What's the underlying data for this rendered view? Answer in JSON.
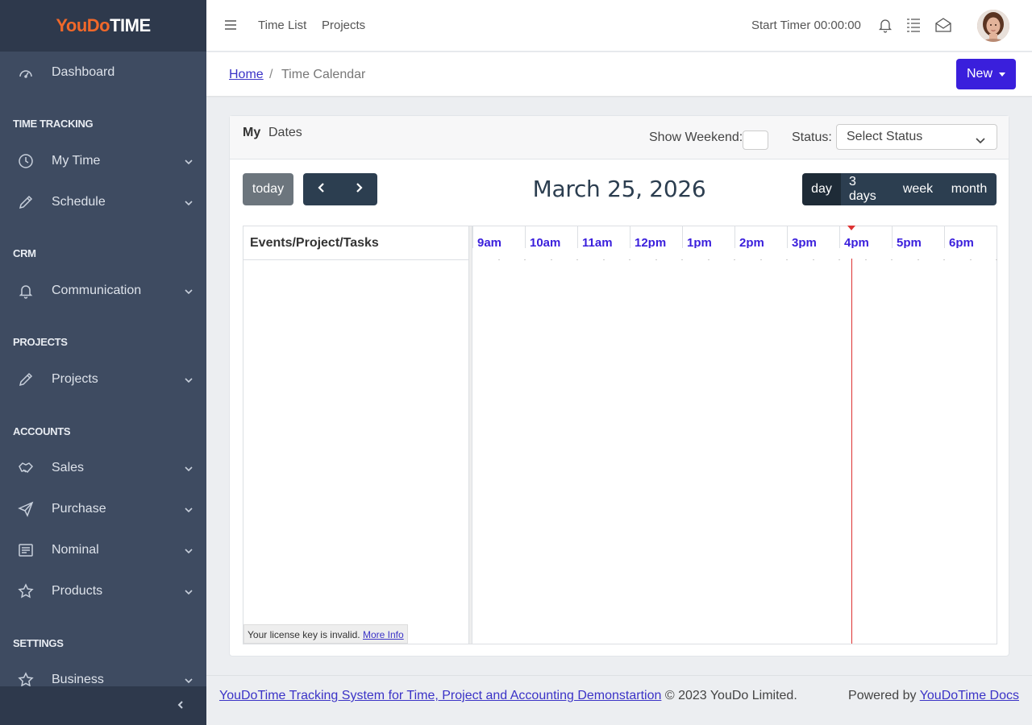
{
  "brand": {
    "part1": "YouDo",
    "part2": "TIME"
  },
  "sidebar": {
    "dashboard": "Dashboard",
    "sections": {
      "time_tracking": "TIME TRACKING",
      "crm": "CRM",
      "projects": "PROJECTS",
      "accounts": "ACCOUNTS",
      "settings": "SETTINGS"
    },
    "items": {
      "my_time": "My Time",
      "schedule": "Schedule",
      "communication": "Communication",
      "projects": "Projects",
      "sales": "Sales",
      "purchase": "Purchase",
      "nominal": "Nominal",
      "products": "Products",
      "business": "Business"
    }
  },
  "topbar": {
    "time_list": "Time List",
    "projects": "Projects",
    "start_timer": "Start Timer 00:00:00"
  },
  "breadcrumb": {
    "home": "Home",
    "separator": "/",
    "current": "Time Calendar"
  },
  "new_button": "New",
  "card": {
    "tab_my": "My",
    "tab_dates": "Dates",
    "show_weekend_label": "Show Weekend:",
    "status_label": "Status:",
    "status_value": "Select Status"
  },
  "calendar": {
    "today": "today",
    "title": "March 25, 2026",
    "views": {
      "day": "day",
      "three_days": "3 days",
      "week": "week",
      "month": "month"
    },
    "active_view": "day",
    "resource_header": "Events/Project/Tasks",
    "hours": [
      "9am",
      "10am",
      "11am",
      "12pm",
      "1pm",
      "2pm",
      "3pm",
      "4pm",
      "5pm",
      "6pm"
    ],
    "license_text": "Your license key is invalid.",
    "license_link": "More Info"
  },
  "footer": {
    "link": "YouDoTime Tracking System for Time, Project and Accounting Demonstartion",
    "copyright": "© 2023 YouDo Limited.",
    "powered_by": "Powered by",
    "docs_link": "YouDoTime Docs"
  },
  "colors": {
    "sidebar_bg": "#3e4b61",
    "brand_orange": "#f0682a",
    "primary": "#3a1fdc",
    "dark_btn": "#2c3e50",
    "now_indicator": "#dd3333"
  }
}
